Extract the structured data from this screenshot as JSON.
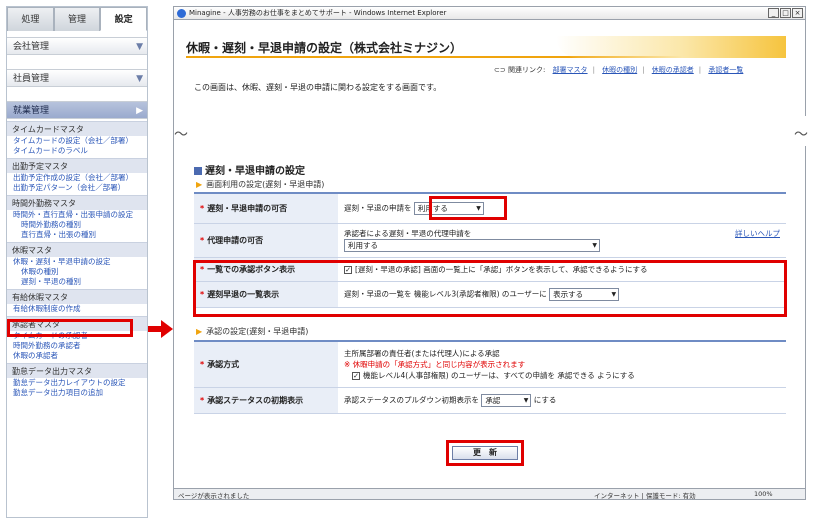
{
  "sidebar": {
    "tabs": [
      "処理",
      "管理",
      "設定"
    ],
    "active_tab": "設定",
    "heads": [
      "会社管理",
      "社員管理",
      "就業管理"
    ],
    "sections": [
      {
        "title": "タイムカードマスタ",
        "links": [
          "タイムカードの設定（会社／部署）",
          "タイムカードのラベル"
        ]
      },
      {
        "title": "出勤予定マスタ",
        "links": [
          "出勤予定作成の設定（会社／部署）",
          "出勤予定パターン（会社／部署）"
        ]
      },
      {
        "title": "時間外勤務マスタ",
        "links": [
          "時間外・直行直帰・出張申請の設定",
          "時間外勤務の種別",
          "直行直帰・出張の種別"
        ]
      },
      {
        "title": "休暇マスタ",
        "links": [
          "休暇・遅刻・早退申請の設定",
          "休暇の種別",
          "遅刻・早退の種別"
        ]
      },
      {
        "title": "有給休暇マスタ",
        "links": [
          "有給休暇制度の作成"
        ]
      },
      {
        "title": "承認者マスタ",
        "links": [
          "タイムカードの承認者",
          "時間外勤務の承認者",
          "休暇の承認者"
        ]
      },
      {
        "title": "勤怠データ出力マスタ",
        "links": [
          "勤怠データ出力レイアウトの設定",
          "勤怠データ出力項目の追加"
        ]
      }
    ]
  },
  "browser": {
    "title": "Minagine - 人事労務のお仕事をまとめてサポート - Windows Internet Explorer",
    "status_msg": "ページが表示されました",
    "zone": "インターネット | 保護モード: 有効",
    "zoom": "100%"
  },
  "page": {
    "title": "休暇・遅刻・早退申請の設定（株式会社ミナジン）",
    "related_label": "関連リンク:",
    "related_links": [
      "部署マスタ",
      "休暇の種別",
      "休暇の承認者",
      "承認者一覧"
    ],
    "intro": "この画面は、休暇、遅刻・早退の申請に関わる設定をする画面です。",
    "section_title": "遅刻・早退申請の設定",
    "subsection1": "画面利用の設定(遅刻・早退申請)",
    "subsection2": "承認の設定(遅刻・早退申請)",
    "rows1": [
      {
        "label": "遅刻・早退申請の可否",
        "text": "遅刻・早退の申請を",
        "select": "利用する"
      },
      {
        "label": "代理申請の可否",
        "text": "承認者による遅刻・早退の代理申請を",
        "select": "利用する",
        "help": "詳しいヘルプ"
      },
      {
        "label": "一覧での承認ボタン表示",
        "text": "[遅刻・早退の承認] 画面の一覧上に「承認」ボタンを表示して、承認できるようにする"
      },
      {
        "label": "遅刻早退の一覧表示",
        "text": "遅刻・早退の一覧を 機能レベル3(承認者権限) のユーザーに",
        "select": "表示する"
      }
    ],
    "rows2": [
      {
        "label": "承認方式",
        "line1": "主所属部署の責任者(または代理人)による承認",
        "warn": "※ 休暇申請の「承認方式」と同じ内容が表示されます",
        "line3": "機能レベル4(人事部権限) のユーザーは、すべての申請を 承認できる ようにする"
      },
      {
        "label": "承認ステータスの初期表示",
        "text": "承認ステータスのプルダウン初期表示を",
        "select": "承認",
        "suffix": "にする"
      }
    ],
    "update_label": "更　新"
  }
}
